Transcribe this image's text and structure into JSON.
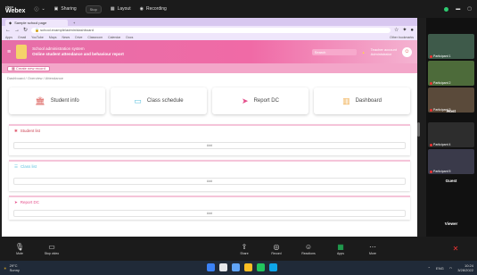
{
  "webex": {
    "brand_top": "cisco",
    "brand": "Webex",
    "meeting_info_label": "Meeting info",
    "share_label": "Sharing",
    "stop_label": "Stop",
    "view_label": "Layout",
    "status": "Recording",
    "colors": {
      "bar": "#1b1b1b",
      "record": "#2ecc71"
    }
  },
  "browser": {
    "tabs": [
      "Sample school page",
      "New tab"
    ],
    "url": "school.example/admin/dashboard",
    "bookmarks": [
      "Apps",
      "Gmail",
      "YouTube",
      "Maps",
      "News",
      "Drive",
      "Classroom",
      "Calendar",
      "Docs"
    ],
    "other_bookmarks": "Other bookmarks"
  },
  "app": {
    "header_line1": "School administration system",
    "header_line2": "Online student attendance and behaviour report",
    "search_placeholder": "Search",
    "user_line1": "Teacher account",
    "user_line2": "Administrator",
    "sub_button": "Create new record",
    "breadcrumb": "Dashboard / Overview / Attendance",
    "colors": {
      "header": "#ee6ca7",
      "accent": "#c0446f"
    }
  },
  "cards": [
    {
      "label": "Student info",
      "icon": "building-icon",
      "color": "#d9534f"
    },
    {
      "label": "Class schedule",
      "icon": "folder-icon",
      "color": "#5bc0de"
    },
    {
      "label": "Report DC",
      "icon": "send-icon",
      "color": "#e44d8a"
    },
    {
      "label": "Dashboard",
      "icon": "chart-icon",
      "color": "#f0ad4e"
    }
  ],
  "panels": [
    {
      "title": "Student list",
      "add_label": "Add",
      "icon_color": "#e0556b"
    },
    {
      "title": "Class list",
      "add_label": "Add",
      "icon_color": "#5bc0de"
    },
    {
      "title": "Report DC",
      "add_label": "Add",
      "icon_color": "#e44d8a"
    }
  ],
  "participants": [
    {
      "name": "Participant 1",
      "cam_color": "#3e5a4a"
    },
    {
      "name": "Participant 2",
      "cam_color": "#4d6b3a"
    },
    {
      "name": "Participant 3",
      "cam_color": "#5a4a3a"
    },
    {
      "name": "Participant 4",
      "cam_color": "#2d2d2d"
    },
    {
      "name": "Participant 5",
      "cam_color": "#3a3a4a"
    }
  ],
  "participant_tiles": [
    {
      "label": "Host"
    },
    {
      "label": "Guest"
    },
    {
      "label": "Viewer"
    }
  ],
  "controls": [
    {
      "icon": "mute-icon",
      "label": "Mute"
    },
    {
      "icon": "video-icon",
      "label": "Stop video"
    },
    {
      "icon": "share-icon",
      "label": "Share"
    },
    {
      "icon": "record-icon",
      "label": "Record"
    },
    {
      "icon": "reactions-icon",
      "label": "Reactions"
    },
    {
      "icon": "apps-icon",
      "label": "Apps"
    },
    {
      "icon": "more-icon",
      "label": "More"
    }
  ],
  "taskbar": {
    "weather_temp": "29°C",
    "weather_text": "Sunny",
    "time": "10:24",
    "date": "3/28/2022",
    "lang": "ENG"
  }
}
